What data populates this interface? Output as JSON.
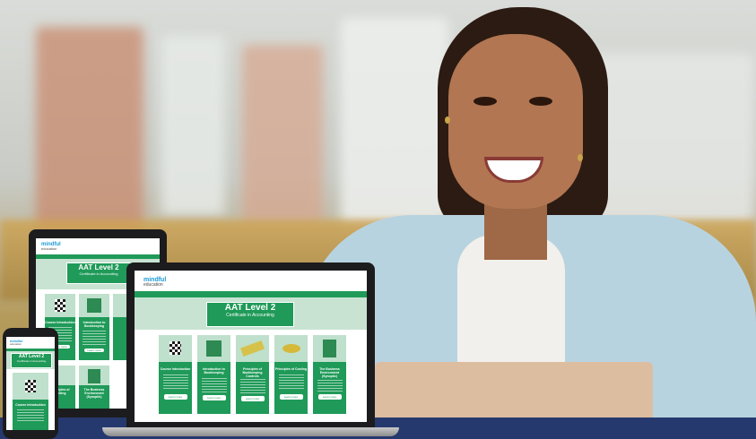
{
  "site": {
    "brand": "mindful",
    "brand_sub": "education"
  },
  "course": {
    "title": "AAT Level 2",
    "subtitle": "Certificate in Accounting"
  },
  "modules": [
    {
      "title": "Course Introduction",
      "button": "Learn more",
      "icon": "checkered-flag-icon"
    },
    {
      "title": "Introduction to Bookkeeping",
      "button": "Learn more",
      "icon": "cube-icon"
    },
    {
      "title": "Principles of Bookkeeping Controls",
      "button": "Learn more",
      "icon": "ledger-icon"
    },
    {
      "title": "Principles of Costing",
      "button": "Learn more",
      "icon": "coins-icon"
    },
    {
      "title": "The Business Environment (Synoptic)",
      "button": "Learn more",
      "icon": "buildings-icon"
    }
  ],
  "colors": {
    "brand_green": "#1f9a58",
    "brand_blue": "#1a9ad6",
    "footer_navy": "#26396e"
  }
}
